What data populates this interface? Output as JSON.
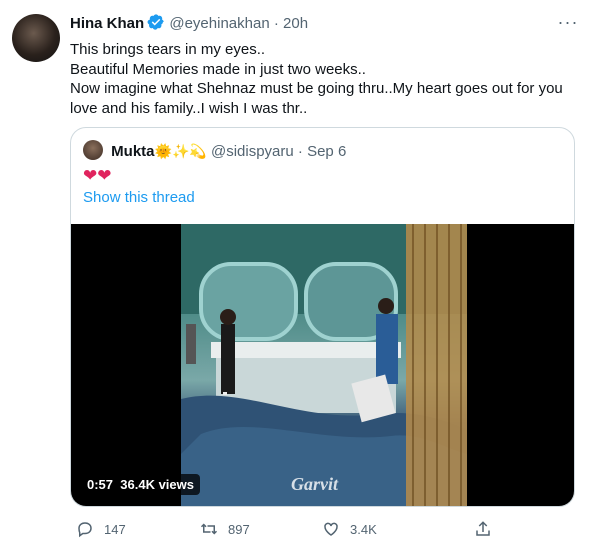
{
  "tweet": {
    "author_name": "Hina Khan",
    "author_handle": "@eyehinakhan",
    "time": "· 20h",
    "lines": [
      "This brings tears in my eyes..",
      "Beautiful Memories made in just two weeks..",
      "Now imagine what Shehnaz must be going thru..My heart goes out for you",
      "love and his family..I wish I was thr.."
    ]
  },
  "quote": {
    "name": "Mukta",
    "emojis": "🌞✨💫",
    "handle": "@sidispyaru",
    "date": "· Sep 6",
    "text": "❤❤",
    "show_thread": "Show this thread",
    "video": {
      "duration": "0:57",
      "views": "36.4K views",
      "watermark": "Garvit"
    }
  },
  "actions": {
    "replies": "147",
    "retweets": "897",
    "likes": "3.4K"
  },
  "colors": {
    "link": "#1d9bf0",
    "secondary": "#536471",
    "heart": "#e0245e"
  }
}
